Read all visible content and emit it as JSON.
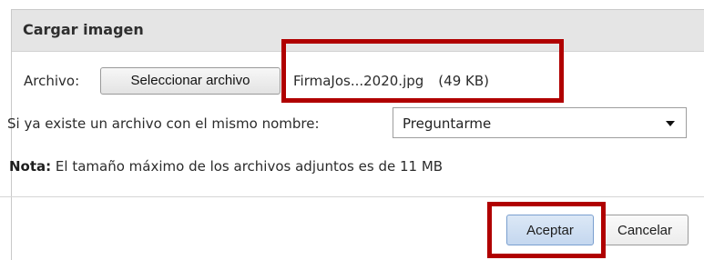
{
  "dialog": {
    "title": "Cargar imagen",
    "file_label": "Archivo:",
    "file_button_label": "Seleccionar archivo",
    "file_name": "FirmaJos...2020.jpg",
    "file_size": "(49 KB)",
    "exists_label": "Si ya existe un archivo con el mismo nombre:",
    "exists_select_value": "Preguntarme",
    "note_bold": "Nota:",
    "note_text": " El tamaño máximo de los archivos adjuntos es de 11 MB",
    "accept_label": "Aceptar",
    "cancel_label": "Cancelar"
  },
  "colors": {
    "highlight": "#b00000",
    "titlebar": "#e5e5e5",
    "accept_button": "#c4d7ef"
  }
}
